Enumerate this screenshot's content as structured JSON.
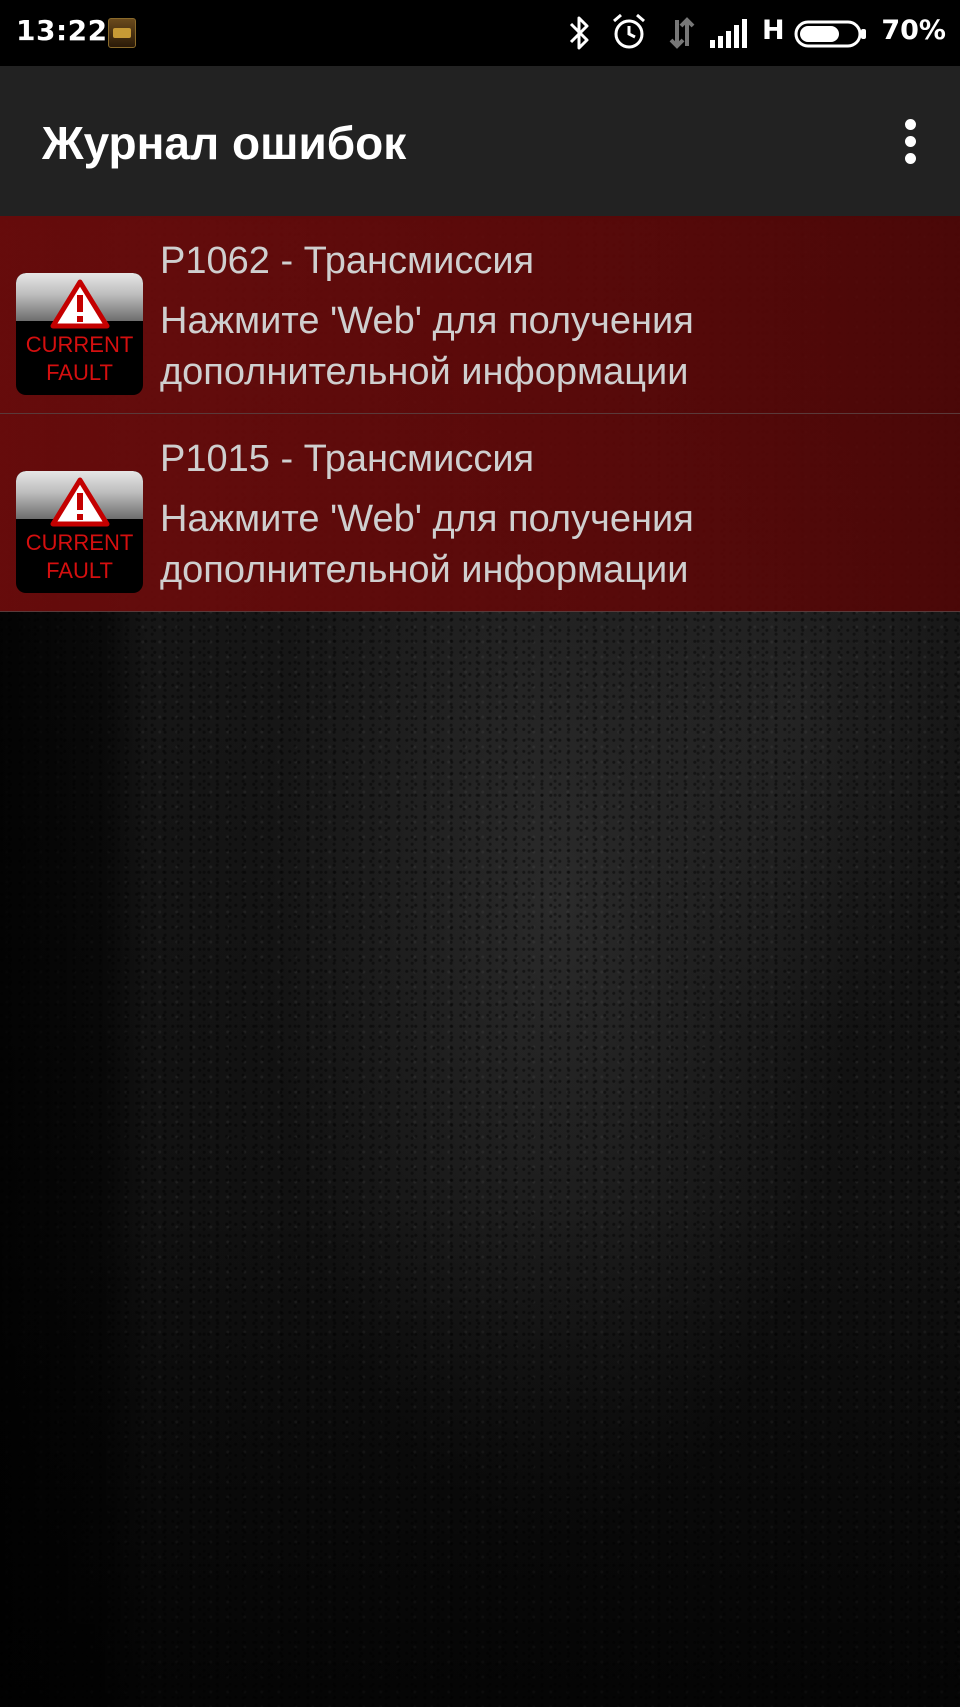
{
  "status_bar": {
    "time": "13:22",
    "app_icon": "obd-app-icon",
    "icons": [
      "bluetooth-icon",
      "alarm-icon",
      "data-arrows-icon",
      "signal-icon"
    ],
    "network_type": "H",
    "battery_percent": "70%",
    "battery_level": 0.7
  },
  "app_bar": {
    "title": "Журнал ошибок",
    "menu_icon": "overflow-menu-icon"
  },
  "faults": [
    {
      "code_title": "P1062 - Трансмиссия",
      "line1": "Нажмите 'Web' для получения",
      "line2": "дополнительной информации",
      "icon_text_1": "CURRENT",
      "icon_text_2": "FAULT"
    },
    {
      "code_title": "P1015 - Трансмиссия",
      "line1": "Нажмите 'Web' для получения",
      "line2": "дополнительной информации",
      "icon_text_1": "CURRENT",
      "icon_text_2": "FAULT"
    }
  ],
  "colors": {
    "row_background": "#6e0c0c",
    "app_bar": "#222222",
    "fault_label": "#d40f0f"
  }
}
